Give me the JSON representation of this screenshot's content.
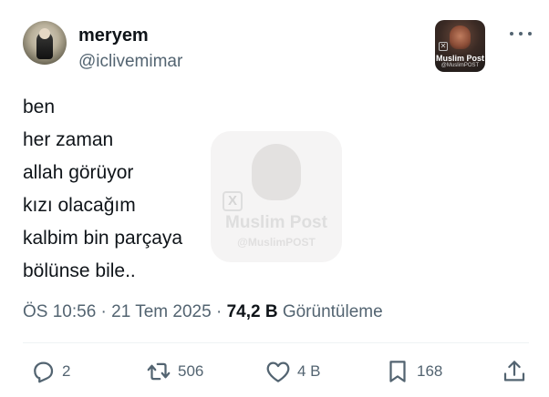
{
  "author": {
    "name": "meryem",
    "handle": "@iclivemimar"
  },
  "badge": {
    "title": "Muslim Post",
    "sub": "@MuslimPOST"
  },
  "watermark": {
    "title": "Muslim Post",
    "sub": "@MuslimPOST"
  },
  "tweet": {
    "lines": [
      "ben",
      "her zaman",
      "allah görüyor",
      "kızı olacağım",
      "kalbim bin parçaya",
      "bölünse bile.."
    ]
  },
  "meta": {
    "time": "ÖS 10:56",
    "sep1": " · ",
    "date": "21 Tem 2025",
    "sep2": " · ",
    "views_count": "74,2 B",
    "views_label": " Görüntüleme"
  },
  "actions": {
    "replies": "2",
    "reposts": "506",
    "likes": "4 B",
    "bookmarks": "168"
  },
  "icons": {
    "more": "more-icon",
    "reply": "reply-icon",
    "repost": "repost-icon",
    "like": "heart-icon",
    "bookmark": "bookmark-icon",
    "share": "share-icon"
  },
  "colors": {
    "text": "#0f1419",
    "secondary": "#536471",
    "divider": "#eff3f4"
  }
}
